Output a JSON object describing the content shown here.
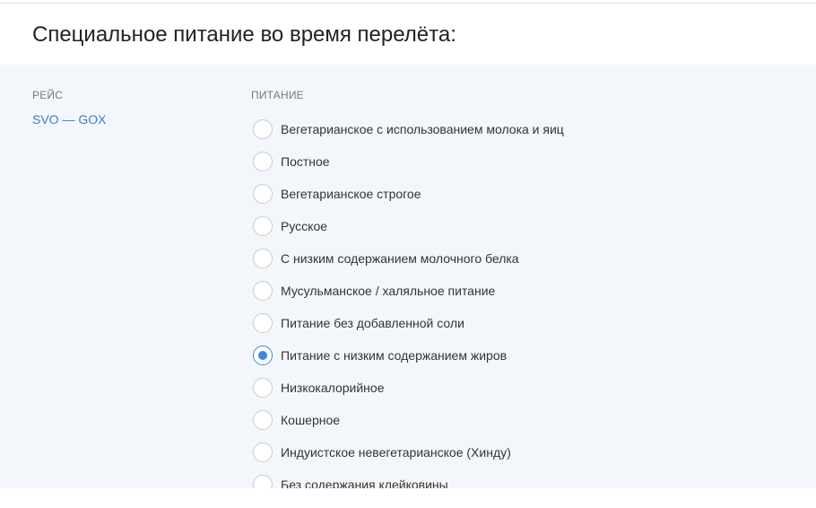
{
  "title": "Специальное питание во время перелёта:",
  "flight_column": {
    "label": "РЕЙС",
    "route": "SVO — GOX"
  },
  "meal_column": {
    "label": "ПИТАНИЕ",
    "options": [
      {
        "label": "Вегетарианское с использованием молока и яиц",
        "selected": false
      },
      {
        "label": "Постное",
        "selected": false
      },
      {
        "label": "Вегетарианское строгое",
        "selected": false
      },
      {
        "label": "Русское",
        "selected": false
      },
      {
        "label": "С низким содержанием молочного белка",
        "selected": false
      },
      {
        "label": "Мусульманское / халяльное питание",
        "selected": false
      },
      {
        "label": "Питание без добавленной соли",
        "selected": false
      },
      {
        "label": "Питание с низким содержанием жиров",
        "selected": true
      },
      {
        "label": "Низкокалорийное",
        "selected": false
      },
      {
        "label": "Кошерное",
        "selected": false
      },
      {
        "label": "Индуистское невегетарианское (Хинду)",
        "selected": false
      },
      {
        "label": "Без содержания клейковины",
        "selected": false
      }
    ]
  },
  "colors": {
    "accent": "#3f86e0",
    "link": "#3f7dc8",
    "panel_background": "#f3f7fc"
  }
}
